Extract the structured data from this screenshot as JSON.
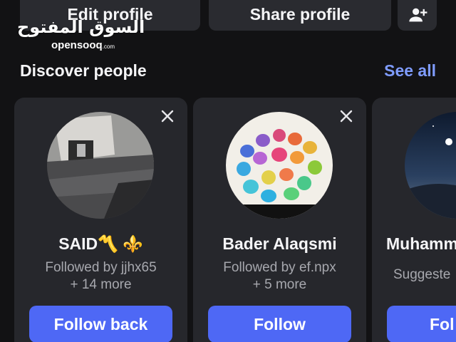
{
  "header": {
    "edit_profile_label": "Edit profile",
    "share_profile_label": "Share profile",
    "add_person_icon": "person-add-icon"
  },
  "watermark": {
    "arabic": "السوق المفتوح",
    "latin": "opensooq",
    "latin_suffix": ".com"
  },
  "discover": {
    "title": "Discover people",
    "see_all_label": "See all"
  },
  "cards": [
    {
      "name": "SAID〽️ ⚜️",
      "subtext_line1": "Followed by jjhx65",
      "subtext_line2": "+ 14 more",
      "button_label": "Follow back",
      "dismiss_icon": "close-icon"
    },
    {
      "name": "Bader Alaqsmi",
      "subtext_line1": "Followed by ef.npx",
      "subtext_line2": "+ 5 more",
      "button_label": "Follow",
      "dismiss_icon": "close-icon"
    },
    {
      "name": "Muhamm",
      "subtext_line1": "Suggeste",
      "button_label": "Fol"
    }
  ],
  "colors": {
    "background": "#121214",
    "card": "#26272c",
    "accent_button": "#4e68f5",
    "link": "#7f9cff",
    "muted_text": "#a7a8ae"
  }
}
